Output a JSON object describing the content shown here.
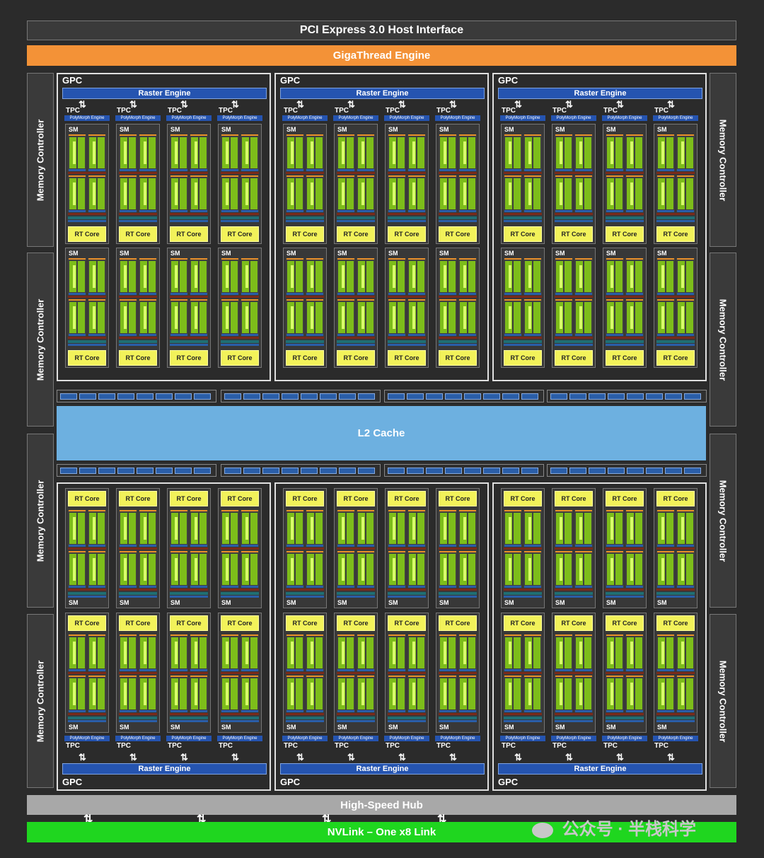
{
  "pci": "PCI Express 3.0 Host Interface",
  "gigathread": "GigaThread Engine",
  "memory_controller": "Memory Controller",
  "gpc_label": "GPC",
  "raster_engine": "Raster Engine",
  "tpc_label": "TPC",
  "polymorph": "PolyMorph Engine",
  "sm_label": "SM",
  "rt_core": "RT Core",
  "l2_cache": "L2 Cache",
  "hub": "High-Speed Hub",
  "nvlink": "NVLink – One x8 Link",
  "watermark": "公众号 · 半栈科学",
  "colors": {
    "background": "#2b2b2b",
    "gigathread": "#f39237",
    "l2": "#6db0e0",
    "hub": "#a8a8a8",
    "nvlink": "#1fd61f",
    "raster": "#2554b0",
    "rt_core": "#f2f25a",
    "cuda_core": "#7dbd1a"
  },
  "icons": [
    "bidirectional-arrow-icon",
    "wechat-icon"
  ]
}
